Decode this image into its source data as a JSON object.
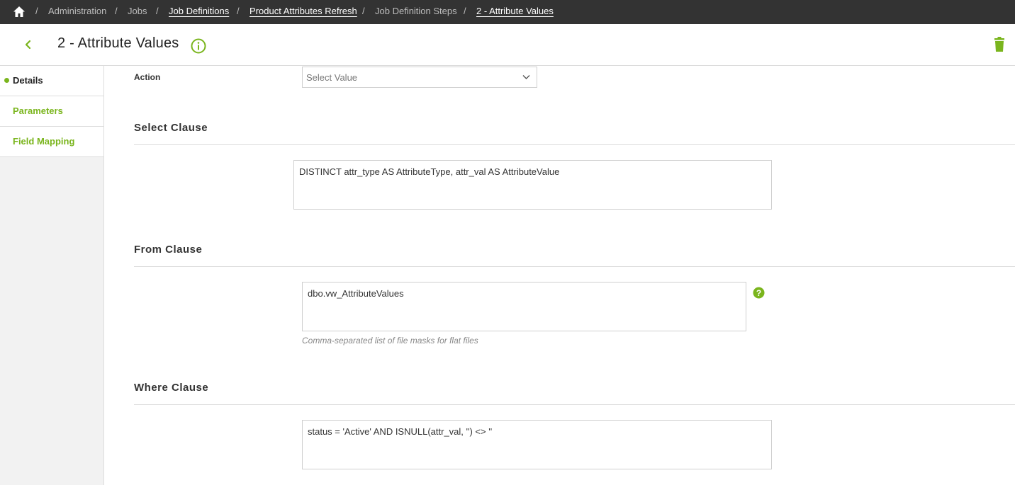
{
  "breadcrumb": {
    "items": [
      {
        "label": "Administration"
      },
      {
        "label": "Jobs"
      },
      {
        "label": "Job Definitions"
      },
      {
        "label": "Product Attributes Refresh"
      },
      {
        "label": "Job Definition Steps"
      },
      {
        "label": "2 - Attribute Values"
      }
    ],
    "separator": "/"
  },
  "header": {
    "title": "2 - Attribute Values"
  },
  "sidebar": {
    "items": [
      {
        "label": "Details"
      },
      {
        "label": "Parameters"
      },
      {
        "label": "Field Mapping"
      }
    ]
  },
  "form": {
    "action_label": "Action",
    "action_placeholder": "Select Value",
    "select_clause": {
      "title": "Select Clause",
      "value": "DISTINCT attr_type AS AttributeType, attr_val AS AttributeValue"
    },
    "from_clause": {
      "title": "From Clause",
      "value": "dbo.vw_AttributeValues",
      "help": "Comma-separated list of file masks for flat files"
    },
    "where_clause": {
      "title": "Where Clause",
      "value": "status = 'Active' AND ISNULL(attr_val, '') <> ''"
    }
  },
  "colors": {
    "accent": "#7ab51d",
    "topbar": "#333333"
  }
}
